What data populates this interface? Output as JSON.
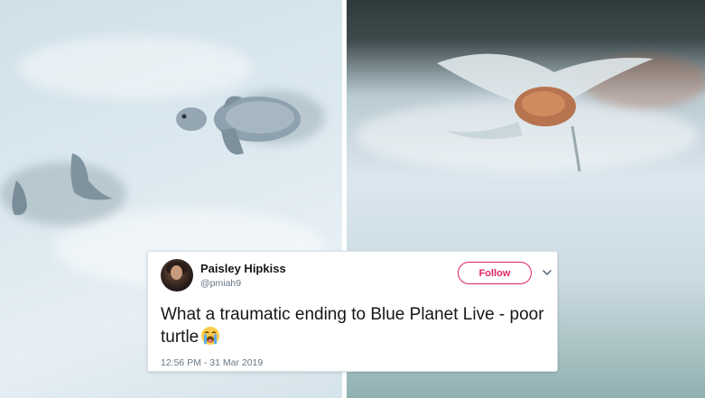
{
  "tweet": {
    "display_name": "Paisley Hipkiss",
    "handle": "@pmiah9",
    "follow_label": "Follow",
    "text": "What a traumatic ending to Blue Planet Live - poor turtle",
    "emoji_icon": "crying-face-emoji-icon",
    "timestamp": "12:56 PM - 31 Mar 2019"
  },
  "colors": {
    "follow_accent": "#e0245e",
    "secondary_text": "#657786",
    "primary_text": "#14171a"
  },
  "icons": [
    "avatar",
    "chevron-down-icon",
    "crying-face-emoji-icon"
  ]
}
